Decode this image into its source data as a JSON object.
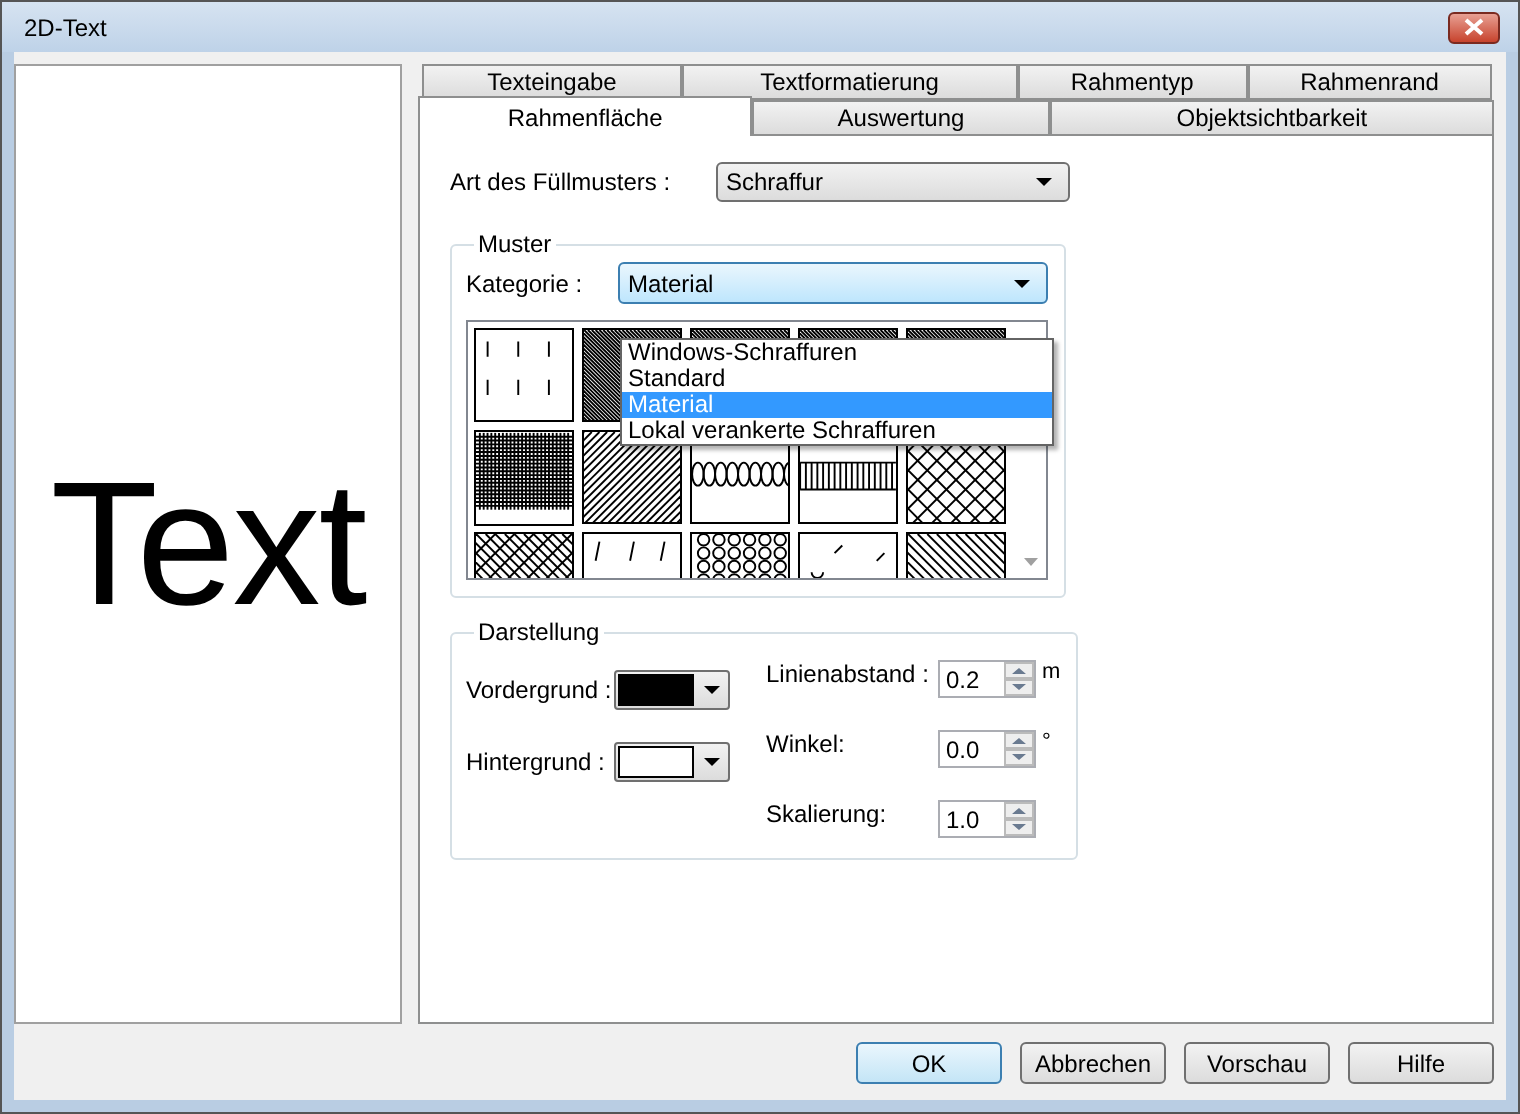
{
  "window": {
    "title": "2D-Text"
  },
  "preview": {
    "text": "Text"
  },
  "tab_rows": [
    {
      "tabs": [
        {
          "label": "Texteingabe",
          "selected": false
        },
        {
          "label": "Textformatierung",
          "selected": false
        },
        {
          "label": "Rahmentyp",
          "selected": false
        },
        {
          "label": "Rahmenrand",
          "selected": false
        }
      ]
    },
    {
      "tabs": [
        {
          "label": "Rahmenfläche",
          "selected": true
        },
        {
          "label": "Auswertung",
          "selected": false
        },
        {
          "label": "Objektsichtbarkeit",
          "selected": false
        }
      ]
    }
  ],
  "fill_type": {
    "label": "Art des Füllmusters :",
    "value": "Schraffur"
  },
  "pattern_group": {
    "title": "Muster",
    "category_label": "Kategorie :",
    "category_value": "Material",
    "category_options": [
      {
        "label": "Windows-Schraffuren",
        "selected": false
      },
      {
        "label": "Standard",
        "selected": false
      },
      {
        "label": "Material",
        "selected": true
      },
      {
        "label": "Lokal verankerte Schraffuren",
        "selected": false
      }
    ]
  },
  "display_group": {
    "title": "Darstellung",
    "colors": [
      {
        "label": "Vordergrund :",
        "color": "#000000"
      },
      {
        "label": "Hintergrund :",
        "color": "#ffffff"
      }
    ],
    "spinners": [
      {
        "label": "Linienabstand :",
        "value": "0.2",
        "unit": "m"
      },
      {
        "label": "Winkel:",
        "value": "0.0",
        "unit": "°"
      },
      {
        "label": "Skalierung:",
        "value": "1.0"
      }
    ]
  },
  "buttons": [
    {
      "label": "OK",
      "default": true
    },
    {
      "label": "Abbrechen",
      "default": false
    },
    {
      "label": "Vorschau",
      "default": false
    },
    {
      "label": "Hilfe",
      "default": false
    }
  ]
}
